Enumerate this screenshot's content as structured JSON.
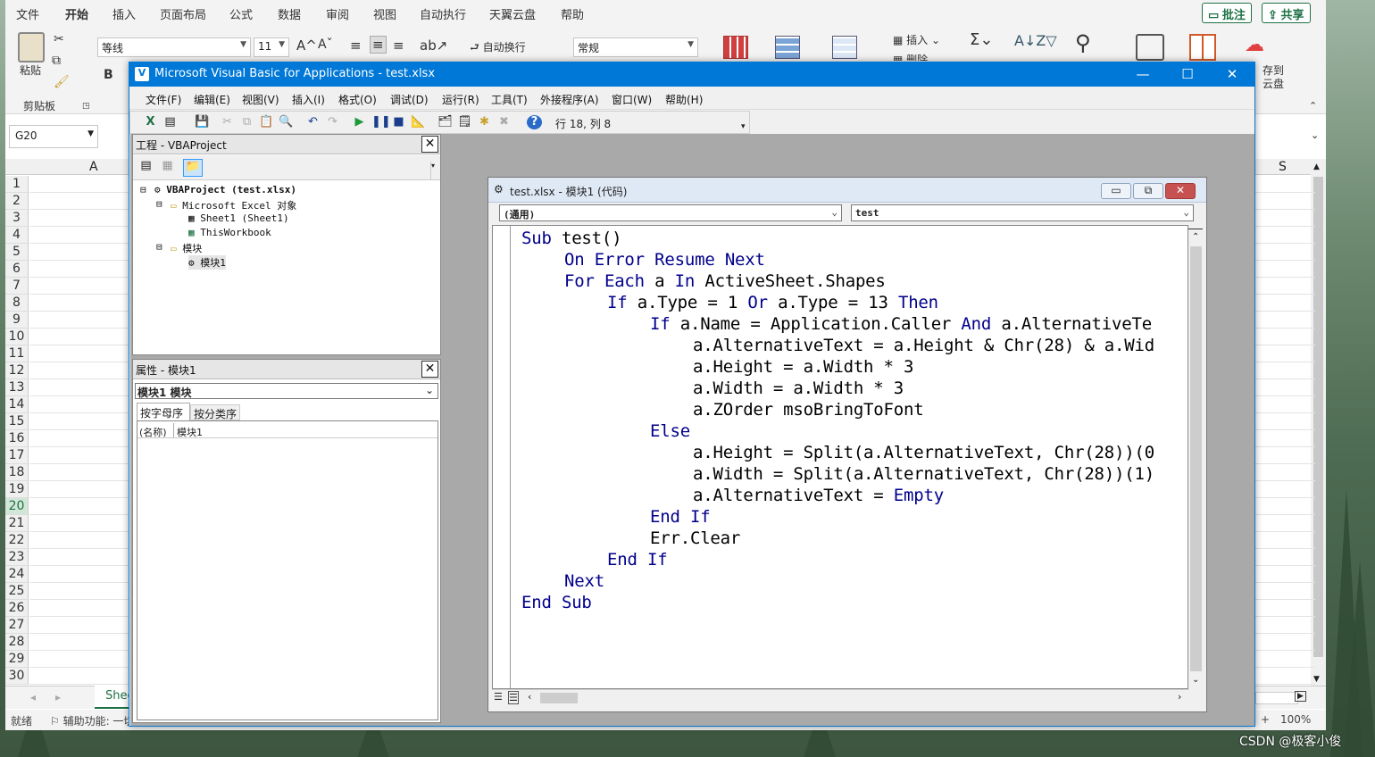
{
  "excel": {
    "ribbon_tabs": [
      "文件",
      "开始",
      "插入",
      "页面布局",
      "公式",
      "数据",
      "审阅",
      "视图",
      "自动执行",
      "天翼云盘",
      "帮助"
    ],
    "active_tab": "开始",
    "comments_label": "批注",
    "share_label": "共享",
    "paste_label": "粘贴",
    "clipboard_label": "剪贴板",
    "font_name": "等线",
    "font_size": "11",
    "bold_label": "B",
    "wrap_label": "自动换行",
    "number_format": "常规",
    "insert_label": "插入",
    "delete_label": "删除",
    "save_cloud_label_1": "存到",
    "save_cloud_label_2": "云盘",
    "name_box": "G20",
    "col_a": "A",
    "col_s": "S",
    "rows": [
      "1",
      "2",
      "3",
      "4",
      "5",
      "6",
      "7",
      "8",
      "9",
      "10",
      "11",
      "12",
      "13",
      "14",
      "15",
      "16",
      "17",
      "18",
      "19",
      "20",
      "21",
      "22",
      "23",
      "24",
      "25",
      "26",
      "27",
      "28",
      "29",
      "30"
    ],
    "selected_row": "20",
    "sheet_tab": "Shee",
    "status_ready": "就绪",
    "status_accessibility": "辅助功能: 一切",
    "zoom": "100%",
    "zoom_plus": "+"
  },
  "vbe": {
    "title": "Microsoft Visual Basic for Applications - test.xlsx",
    "menu": [
      "文件(F)",
      "编辑(E)",
      "视图(V)",
      "插入(I)",
      "格式(O)",
      "调试(D)",
      "运行(R)",
      "工具(T)",
      "外接程序(A)",
      "窗口(W)",
      "帮助(H)"
    ],
    "cursor_pos": "行 18, 列 8",
    "project_title": "工程 - VBAProject",
    "project_tree": {
      "root": "VBAProject (test.xlsx)",
      "excel_objects": "Microsoft Excel 对象",
      "sheet1": "Sheet1 (Sheet1)",
      "thisworkbook": "ThisWorkbook",
      "modules": "模块",
      "module1": "模块1"
    },
    "props_title": "属性 - 模块1",
    "props_combo": "模块1 模块",
    "props_tab_alpha": "按字母序",
    "props_tab_cat": "按分类序",
    "props_name_key": "(名称)",
    "props_name_val": "模块1",
    "code_title": "test.xlsx - 模块1 (代码)",
    "code_object": "(通用)",
    "code_proc": "test",
    "code_lines": [
      {
        "indent": 0,
        "parts": [
          [
            "kw",
            "Sub"
          ],
          [
            "n",
            " test()"
          ]
        ]
      },
      {
        "indent": 1,
        "parts": [
          [
            "kw",
            "On Error Resume Next"
          ]
        ]
      },
      {
        "indent": 1,
        "parts": [
          [
            "kw",
            "For Each"
          ],
          [
            "n",
            " a "
          ],
          [
            "kw",
            "In"
          ],
          [
            "n",
            " ActiveSheet.Shapes"
          ]
        ]
      },
      {
        "indent": 2,
        "parts": [
          [
            "kw",
            "If"
          ],
          [
            "n",
            " a.Type = 1 "
          ],
          [
            "kw",
            "Or"
          ],
          [
            "n",
            " a.Type = 13 "
          ],
          [
            "kw",
            "Then"
          ]
        ]
      },
      {
        "indent": 3,
        "parts": [
          [
            "kw",
            "If"
          ],
          [
            "n",
            " a.Name = Application.Caller "
          ],
          [
            "kw",
            "And"
          ],
          [
            "n",
            " a.AlternativeTe"
          ]
        ]
      },
      {
        "indent": 4,
        "parts": [
          [
            "n",
            "a.AlternativeText = a.Height & Chr(28) & a.Wid"
          ]
        ]
      },
      {
        "indent": 4,
        "parts": [
          [
            "n",
            "a.Height = a.Width * 3"
          ]
        ]
      },
      {
        "indent": 4,
        "parts": [
          [
            "n",
            "a.Width = a.Width * 3"
          ]
        ]
      },
      {
        "indent": 4,
        "parts": [
          [
            "n",
            "a.ZOrder msoBringToFont"
          ]
        ]
      },
      {
        "indent": 3,
        "parts": [
          [
            "kw",
            "Else"
          ]
        ]
      },
      {
        "indent": 4,
        "parts": [
          [
            "n",
            "a.Height = Split(a.AlternativeText, Chr(28))(0"
          ]
        ]
      },
      {
        "indent": 4,
        "parts": [
          [
            "n",
            "a.Width = Split(a.AlternativeText, Chr(28))(1)"
          ]
        ]
      },
      {
        "indent": 4,
        "parts": [
          [
            "n",
            "a.AlternativeText = "
          ],
          [
            "kw",
            "Empty"
          ]
        ]
      },
      {
        "indent": 3,
        "parts": [
          [
            "kw",
            "End If"
          ]
        ]
      },
      {
        "indent": 3,
        "parts": [
          [
            "n",
            "Err.Clear"
          ]
        ]
      },
      {
        "indent": 2,
        "parts": [
          [
            "kw",
            "End If"
          ]
        ]
      },
      {
        "indent": 1,
        "parts": [
          [
            "kw",
            "Next"
          ]
        ]
      },
      {
        "indent": 0,
        "parts": [
          [
            "kw",
            "End Sub"
          ]
        ]
      }
    ]
  },
  "watermark": "CSDN @极客小俊",
  "colors": {
    "vbe_title": "#0078d7",
    "keyword": "#00008b",
    "excel_green": "#1e7145"
  }
}
